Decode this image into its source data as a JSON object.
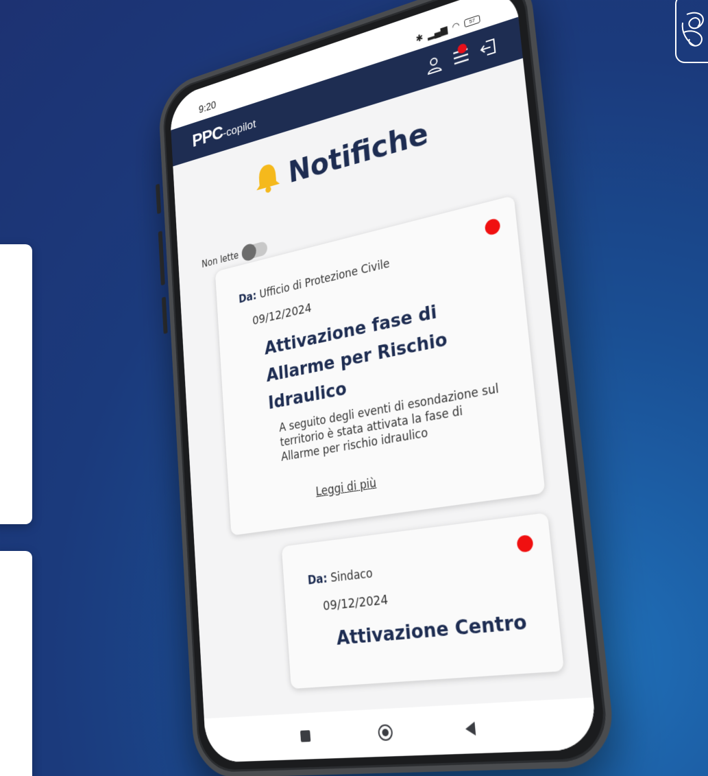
{
  "status_bar": {
    "time": "9:20",
    "battery": "57"
  },
  "app": {
    "logo_bold": "PPC",
    "logo_suffix": "-copilot"
  },
  "page": {
    "title": "Notifiche"
  },
  "filter": {
    "label": "Non lette",
    "toggle_on": false
  },
  "notifications": [
    {
      "from_label": "Da:",
      "from": "Ufficio di Protezione Civile",
      "date": "09/12/2024",
      "title": "Attivazione fase di Allarme per Rischio Idraulico",
      "body": "A seguito degli eventi di esondazione sul territorio è stata attivata la fase di Allarme per rischio idraulico",
      "link": "Leggi di più",
      "unread": true
    },
    {
      "from_label": "Da:",
      "from": "Sindaco",
      "date": "09/12/2024",
      "title": "Attivazione Centro",
      "unread": true
    }
  ],
  "colors": {
    "app_bar": "#1e2d52",
    "unread_dot": "#f01010",
    "bell": "#f5b91c",
    "background": "#1b3a7c"
  },
  "icons": [
    "user-icon",
    "menu-icon",
    "logout-icon",
    "bell-icon",
    "bluetooth-icon",
    "signal-icon",
    "wifi-icon",
    "battery-icon"
  ]
}
